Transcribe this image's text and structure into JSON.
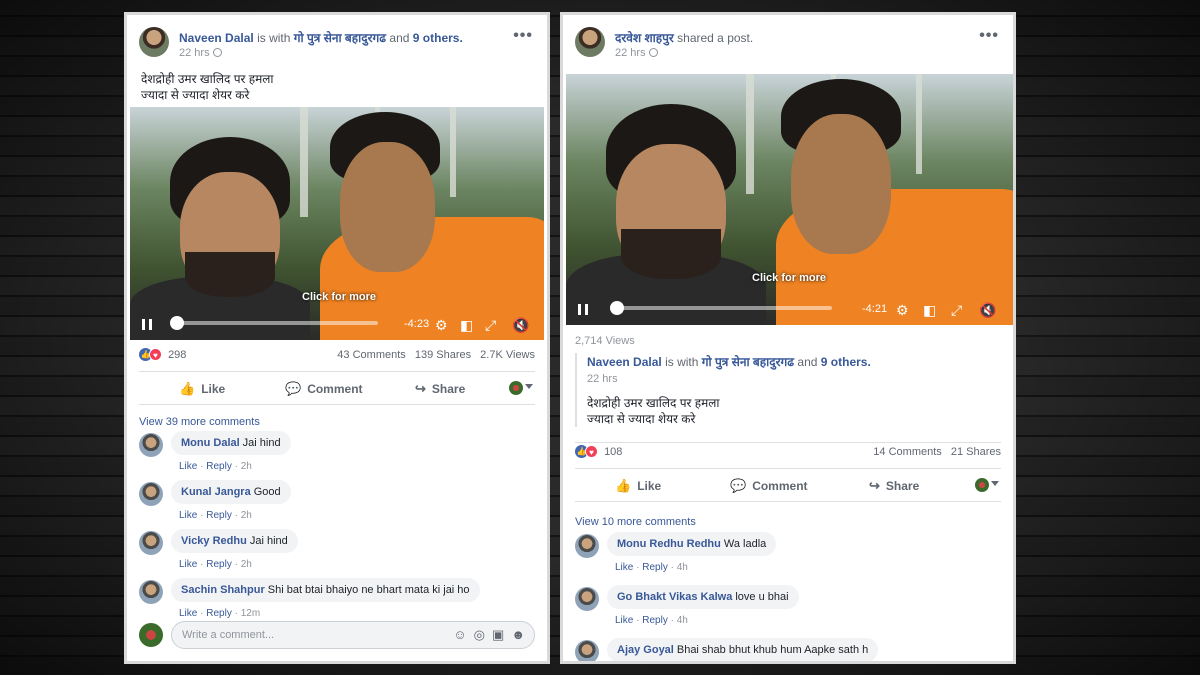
{
  "left_post": {
    "author": "Naveen Dalal",
    "with_text": "is with",
    "tagged_page": "गो पुत्र सेना बहादुरगढ",
    "and_text": "and",
    "others": "9 others.",
    "time": "22 hrs",
    "caption_line1": "देशद्रोही उमर खालिद पर हमला",
    "caption_line2": "ज्यादा से ज्यादा शेयर करे",
    "video": {
      "click_more": "Click for more",
      "remaining": "-4:23",
      "progress": 0.0
    },
    "reactions_count": "298",
    "comments_count": "43 Comments",
    "shares_count": "139 Shares",
    "views_count": "2.7K Views",
    "actions": {
      "like": "Like",
      "comment": "Comment",
      "share": "Share"
    },
    "view_more": "View 39 more comments",
    "comments": [
      {
        "name": "Monu Dalal",
        "text": "Jai hind",
        "like": "Like",
        "reply": "Reply",
        "time": "2h"
      },
      {
        "name": "Kunal Jangra",
        "text": "Good",
        "like": "Like",
        "reply": "Reply",
        "time": "2h"
      },
      {
        "name": "Vicky Redhu",
        "text": "Jai hind",
        "like": "Like",
        "reply": "Reply",
        "time": "2h"
      },
      {
        "name": "Sachin Shahpur",
        "text": "Shi bat btai bhaiyo ne bhart mata ki jai ho",
        "like": "Like",
        "reply": "Reply",
        "time": "12m"
      }
    ],
    "write_placeholder": "Write a comment..."
  },
  "right_post": {
    "author": "दरवेश शाहपुर",
    "shared_text": "shared a post.",
    "time": "22 hrs",
    "video": {
      "click_more": "Click for more",
      "remaining": "-4:21",
      "progress": 0.0
    },
    "views": "2,714 Views",
    "shared": {
      "author": "Naveen Dalal",
      "with_text": "is with",
      "tagged_page": "गो पुत्र सेना बहादुरगढ",
      "and_text": "and",
      "others": "9 others.",
      "time": "22 hrs",
      "caption_line1": "देशद्रोही उमर खालिद पर हमला",
      "caption_line2": "ज्यादा से ज्यादा शेयर करे"
    },
    "reactions_count": "108",
    "comments_count": "14 Comments",
    "shares_count": "21 Shares",
    "actions": {
      "like": "Like",
      "comment": "Comment",
      "share": "Share"
    },
    "view_more": "View 10 more comments",
    "comments": [
      {
        "name": "Monu Redhu Redhu",
        "text": "Wa ladla",
        "like": "Like",
        "reply": "Reply",
        "time": "4h"
      },
      {
        "name": "Go Bhakt Vikas Kalwa",
        "text": "love u bhai",
        "like": "Like",
        "reply": "Reply",
        "time": "4h"
      },
      {
        "name": "Ajay Goyal",
        "text": "Bhai shab bhut khub hum Aapke sath h"
      }
    ]
  },
  "colors": {
    "link": "#385898",
    "scarf": "#ef8222",
    "like": "#4267b2",
    "love": "#f33e58"
  },
  "icons": [
    "more-dots-icon",
    "globe-icon",
    "play-pause-icon",
    "settings-icon",
    "fullscreen-icon",
    "volume-icon",
    "like-icon",
    "comment-icon",
    "share-icon",
    "emoji-icon",
    "camera-icon",
    "gif-icon",
    "sticker-icon"
  ]
}
